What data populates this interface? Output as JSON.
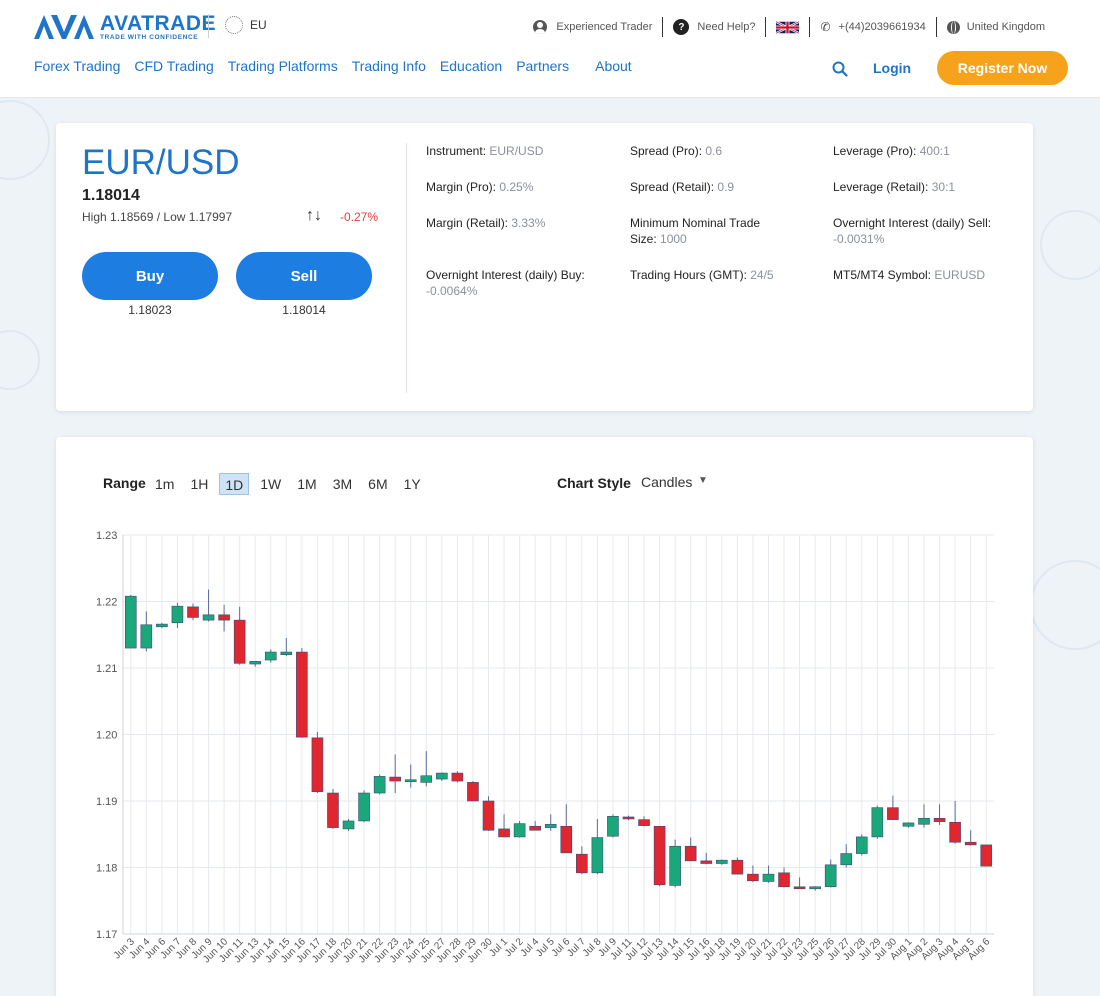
{
  "header": {
    "logo_word": "AVATRADE",
    "logo_tag": "TRADE WITH CONFIDENCE",
    "region": "EU",
    "topbar": {
      "trader": "Experienced Trader",
      "help": "Need Help?",
      "phone": "+(44)2039661934",
      "country": "United Kingdom"
    },
    "nav": [
      "Forex Trading",
      "CFD Trading",
      "Trading Platforms",
      "Trading Info",
      "Education",
      "Partners",
      "About"
    ],
    "login": "Login",
    "register": "Register Now"
  },
  "instrument": {
    "pair": "EUR/USD",
    "price": "1.18014",
    "high_low": "High 1.18569 / Low 1.17997",
    "change": "-0.27%",
    "buy_label": "Buy",
    "sell_label": "Sell",
    "buy_price": "1.18023",
    "sell_price": "1.18014"
  },
  "specs": [
    {
      "label": "Instrument:",
      "value": "EUR/USD"
    },
    {
      "label": "Spread (Pro):",
      "value": "0.6"
    },
    {
      "label": "Leverage (Pro):",
      "value": "400:1"
    },
    {
      "label": "Margin (Pro):",
      "value": "0.25%"
    },
    {
      "label": "Spread (Retail):",
      "value": "0.9"
    },
    {
      "label": "Leverage (Retail):",
      "value": "30:1"
    },
    {
      "label": "Margin (Retail):",
      "value": "3.33%"
    },
    {
      "label": "Minimum Nominal Trade Size:",
      "value": "1000"
    },
    {
      "label": "Overnight Interest (daily) Sell:",
      "value": "-0.0031%"
    },
    {
      "label": "Overnight Interest (daily) Buy:",
      "value": "-0.0064%"
    },
    {
      "label": "Trading Hours (GMT):",
      "value": "24/5"
    },
    {
      "label": "MT5/MT4 Symbol:",
      "value": "EURUSD"
    }
  ],
  "chart_controls": {
    "range_label": "Range",
    "ranges": [
      "1m",
      "1H",
      "1D",
      "1W",
      "1M",
      "3M",
      "6M",
      "1Y"
    ],
    "active_range": "1D",
    "style_label": "Chart Style",
    "style_value": "Candles"
  },
  "colors": {
    "up": "#1aa77a",
    "down": "#e0262f",
    "brand": "#1e74c8",
    "cta": "#f7a21b"
  },
  "chart_data": {
    "type": "candlestick",
    "ylim": [
      1.17,
      1.23
    ],
    "yticks": [
      "1.17",
      "1.18",
      "1.19",
      "1.20",
      "1.21",
      "1.22",
      "1.23"
    ],
    "grid": true,
    "categories": [
      "Jun 3",
      "Jun 4",
      "Jun 6",
      "Jun 7",
      "Jun 8",
      "Jun 9",
      "Jun 10",
      "Jun 11",
      "Jun 13",
      "Jun 14",
      "Jun 15",
      "Jun 16",
      "Jun 17",
      "Jun 18",
      "Jun 20",
      "Jun 21",
      "Jun 22",
      "Jun 23",
      "Jun 24",
      "Jun 25",
      "Jun 27",
      "Jun 28",
      "Jun 29",
      "Jun 30",
      "Jul 1",
      "Jul 2",
      "Jul 4",
      "Jul 5",
      "Jul 6",
      "Jul 7",
      "Jul 8",
      "Jul 9",
      "Jul 11",
      "Jul 12",
      "Jul 13",
      "Jul 14",
      "Jul 15",
      "Jul 16",
      "Jul 18",
      "Jul 19",
      "Jul 20",
      "Jul 21",
      "Jul 22",
      "Jul 23",
      "Jul 25",
      "Jul 26",
      "Jul 27",
      "Jul 28",
      "Jul 29",
      "Jul 30",
      "Aug 1",
      "Aug 2",
      "Aug 3",
      "Aug 4",
      "Aug 5",
      "Aug 6"
    ],
    "candles": [
      {
        "o": 1.213,
        "h": 1.221,
        "l": 1.213,
        "c": 1.2208
      },
      {
        "o": 1.213,
        "h": 1.2185,
        "l": 1.2125,
        "c": 1.2165
      },
      {
        "o": 1.2162,
        "h": 1.2168,
        "l": 1.216,
        "c": 1.2166
      },
      {
        "o": 1.2168,
        "h": 1.2198,
        "l": 1.216,
        "c": 1.2193
      },
      {
        "o": 1.2192,
        "h": 1.2197,
        "l": 1.2172,
        "c": 1.2176
      },
      {
        "o": 1.2172,
        "h": 1.2218,
        "l": 1.217,
        "c": 1.218
      },
      {
        "o": 1.218,
        "h": 1.2195,
        "l": 1.2155,
        "c": 1.2172
      },
      {
        "o": 1.2172,
        "h": 1.2192,
        "l": 1.2105,
        "c": 1.2107
      },
      {
        "o": 1.2106,
        "h": 1.211,
        "l": 1.2102,
        "c": 1.211
      },
      {
        "o": 1.2112,
        "h": 1.2128,
        "l": 1.2108,
        "c": 1.2124
      },
      {
        "o": 1.212,
        "h": 1.2145,
        "l": 1.2118,
        "c": 1.2124
      },
      {
        "o": 1.2124,
        "h": 1.213,
        "l": 1.1995,
        "c": 1.1996
      },
      {
        "o": 1.1995,
        "h": 1.2004,
        "l": 1.1912,
        "c": 1.1914
      },
      {
        "o": 1.1912,
        "h": 1.1918,
        "l": 1.1858,
        "c": 1.186
      },
      {
        "o": 1.1858,
        "h": 1.1873,
        "l": 1.1855,
        "c": 1.187
      },
      {
        "o": 1.187,
        "h": 1.1916,
        "l": 1.1868,
        "c": 1.1912
      },
      {
        "o": 1.1912,
        "h": 1.194,
        "l": 1.191,
        "c": 1.1937
      },
      {
        "o": 1.1936,
        "h": 1.197,
        "l": 1.1912,
        "c": 1.193
      },
      {
        "o": 1.193,
        "h": 1.1955,
        "l": 1.192,
        "c": 1.1932
      },
      {
        "o": 1.1928,
        "h": 1.1975,
        "l": 1.1922,
        "c": 1.1938
      },
      {
        "o": 1.1933,
        "h": 1.1943,
        "l": 1.193,
        "c": 1.1942
      },
      {
        "o": 1.1942,
        "h": 1.1945,
        "l": 1.1928,
        "c": 1.193
      },
      {
        "o": 1.1928,
        "h": 1.193,
        "l": 1.19,
        "c": 1.19
      },
      {
        "o": 1.19,
        "h": 1.1907,
        "l": 1.1855,
        "c": 1.1856
      },
      {
        "o": 1.1858,
        "h": 1.188,
        "l": 1.1845,
        "c": 1.1846
      },
      {
        "o": 1.1846,
        "h": 1.187,
        "l": 1.1845,
        "c": 1.1866
      },
      {
        "o": 1.1862,
        "h": 1.187,
        "l": 1.1857,
        "c": 1.1856
      },
      {
        "o": 1.186,
        "h": 1.188,
        "l": 1.1855,
        "c": 1.1865
      },
      {
        "o": 1.1862,
        "h": 1.1895,
        "l": 1.1825,
        "c": 1.1822
      },
      {
        "o": 1.182,
        "h": 1.1832,
        "l": 1.179,
        "c": 1.1792
      },
      {
        "o": 1.1792,
        "h": 1.1873,
        "l": 1.179,
        "c": 1.1845
      },
      {
        "o": 1.1847,
        "h": 1.188,
        "l": 1.1845,
        "c": 1.1877
      },
      {
        "o": 1.1876,
        "h": 1.1878,
        "l": 1.1871,
        "c": 1.1873
      },
      {
        "o": 1.1872,
        "h": 1.1877,
        "l": 1.1862,
        "c": 1.1863
      },
      {
        "o": 1.1862,
        "h": 1.1862,
        "l": 1.1772,
        "c": 1.1774
      },
      {
        "o": 1.1773,
        "h": 1.1842,
        "l": 1.177,
        "c": 1.1832
      },
      {
        "o": 1.1832,
        "h": 1.1845,
        "l": 1.181,
        "c": 1.181
      },
      {
        "o": 1.181,
        "h": 1.1822,
        "l": 1.1805,
        "c": 1.1806
      },
      {
        "o": 1.1806,
        "h": 1.1812,
        "l": 1.1804,
        "c": 1.1811
      },
      {
        "o": 1.1811,
        "h": 1.1815,
        "l": 1.179,
        "c": 1.179
      },
      {
        "o": 1.179,
        "h": 1.1803,
        "l": 1.1778,
        "c": 1.178
      },
      {
        "o": 1.1779,
        "h": 1.1803,
        "l": 1.1777,
        "c": 1.179
      },
      {
        "o": 1.1792,
        "h": 1.18,
        "l": 1.177,
        "c": 1.1771
      },
      {
        "o": 1.1771,
        "h": 1.1785,
        "l": 1.1768,
        "c": 1.1768
      },
      {
        "o": 1.1768,
        "h": 1.1772,
        "l": 1.1765,
        "c": 1.1771
      },
      {
        "o": 1.1771,
        "h": 1.1812,
        "l": 1.177,
        "c": 1.1804
      },
      {
        "o": 1.1804,
        "h": 1.1835,
        "l": 1.18,
        "c": 1.1821
      },
      {
        "o": 1.1821,
        "h": 1.185,
        "l": 1.1818,
        "c": 1.1846
      },
      {
        "o": 1.1846,
        "h": 1.1893,
        "l": 1.1843,
        "c": 1.189
      },
      {
        "o": 1.189,
        "h": 1.1908,
        "l": 1.1872,
        "c": 1.1872
      },
      {
        "o": 1.1862,
        "h": 1.1868,
        "l": 1.186,
        "c": 1.1867
      },
      {
        "o": 1.1865,
        "h": 1.1895,
        "l": 1.186,
        "c": 1.1874
      },
      {
        "o": 1.1874,
        "h": 1.1895,
        "l": 1.1864,
        "c": 1.1869
      },
      {
        "o": 1.1868,
        "h": 1.19,
        "l": 1.1836,
        "c": 1.1838
      },
      {
        "o": 1.1838,
        "h": 1.1856,
        "l": 1.1833,
        "c": 1.1834
      },
      {
        "o": 1.1834,
        "h": 1.1834,
        "l": 1.1802,
        "c": 1.1802
      }
    ]
  }
}
